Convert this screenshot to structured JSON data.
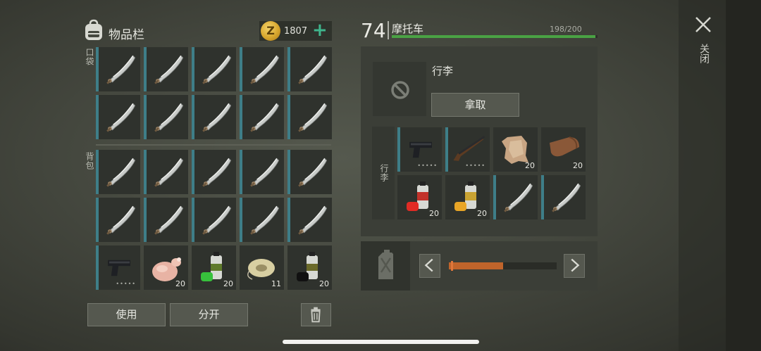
{
  "inventory": {
    "title": "物品栏",
    "coin_icon": "coin-icon",
    "coin_symbol": "Z",
    "coins": "1807",
    "add_icon": "plus-icon",
    "pockets_label": "口袋",
    "backpack_label": "背包",
    "pockets": [
      {
        "item": "machete-icon",
        "qty": ""
      },
      {
        "item": "machete-icon",
        "qty": ""
      },
      {
        "item": "machete-icon",
        "qty": ""
      },
      {
        "item": "machete-icon",
        "qty": ""
      },
      {
        "item": "machete-icon",
        "qty": ""
      },
      {
        "item": "machete-icon",
        "qty": ""
      },
      {
        "item": "machete-icon",
        "qty": ""
      },
      {
        "item": "machete-icon",
        "qty": ""
      },
      {
        "item": "machete-icon",
        "qty": ""
      },
      {
        "item": "machete-icon",
        "qty": ""
      }
    ],
    "backpack": [
      {
        "item": "machete-icon",
        "qty": ""
      },
      {
        "item": "machete-icon",
        "qty": ""
      },
      {
        "item": "machete-icon",
        "qty": ""
      },
      {
        "item": "machete-icon",
        "qty": ""
      },
      {
        "item": "machete-icon",
        "qty": ""
      },
      {
        "item": "machete-icon",
        "qty": ""
      },
      {
        "item": "machete-icon",
        "qty": ""
      },
      {
        "item": "machete-icon",
        "qty": ""
      },
      {
        "item": "machete-icon",
        "qty": ""
      },
      {
        "item": "machete-icon",
        "qty": ""
      },
      {
        "item": "pistol-icon",
        "qty": "•••••"
      },
      {
        "item": "raw-chicken-icon",
        "qty": "20"
      },
      {
        "item": "green-spray-paint-icon",
        "qty": "20"
      },
      {
        "item": "wire-spool-icon",
        "qty": "11"
      },
      {
        "item": "black-spray-paint-icon",
        "qty": "20"
      }
    ],
    "use_button": "使用",
    "split_button": "分开",
    "trash_icon": "trash-icon"
  },
  "vehicle": {
    "level": "74",
    "name": "摩托车",
    "hp_text": "198/200",
    "hp_value": 198,
    "hp_max": 200,
    "storage_label": "行李",
    "take_button": "拿取",
    "cargo_label": "行李",
    "cargo": [
      {
        "item": "pistol-icon",
        "qty": "•••••"
      },
      {
        "item": "shotgun-icon",
        "qty": "•••••"
      },
      {
        "item": "animal-hide-icon",
        "qty": "20"
      },
      {
        "item": "leather-icon",
        "qty": "20"
      },
      {
        "item": "red-spray-paint-icon",
        "qty": "20"
      },
      {
        "item": "yellow-spray-paint-icon",
        "qty": "20"
      },
      {
        "item": "machete-icon",
        "qty": ""
      },
      {
        "item": "machete-icon",
        "qty": ""
      }
    ],
    "fuel_level": 0.5
  },
  "close_label": "关闭",
  "colors": {
    "hp": "#4aa244",
    "fuel": "#c0642b",
    "accent": "#3fb58c",
    "slot_bar": "#3e7e88"
  }
}
